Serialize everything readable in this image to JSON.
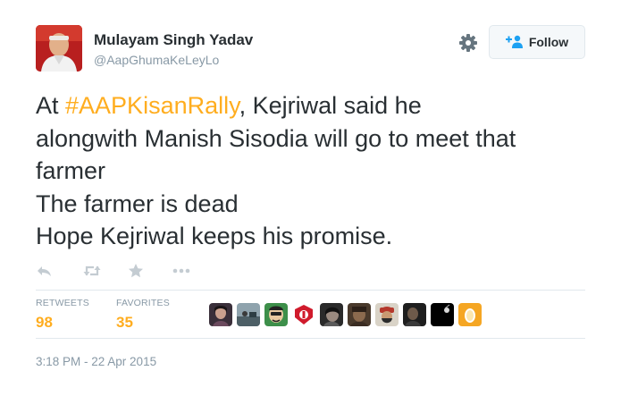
{
  "author": {
    "name": "Mulayam Singh Yadav",
    "handle": "@AapGhumaKeLeyLo"
  },
  "follow_button": {
    "label": "Follow"
  },
  "tweet": {
    "text_lines": [
      {
        "hashtag": "#AAPKisanRally",
        "prefix": "At ",
        "suffix": ", Kejriwal said he"
      },
      "alongwith Manish Sisodia will go to meet that",
      "farmer",
      "The farmer is dead",
      "Hope Kejriwal keeps his promise."
    ]
  },
  "stats": {
    "retweets": {
      "label": "RETWEETS",
      "value": "98"
    },
    "favorites": {
      "label": "FAVORITES",
      "value": "35"
    }
  },
  "timestamp": "3:18 PM - 22 Apr 2015",
  "icons": {
    "reply": "reply-icon",
    "retweet": "retweet-icon",
    "favorite": "star-icon",
    "more": "more-icon",
    "settings": "gear-icon",
    "follow": "add-user-icon"
  },
  "colors": {
    "hashtag": "#ffad1f",
    "stat_value": "#ffad1f",
    "muted": "#8899a6",
    "text": "#292f33",
    "divider": "#e1e8ed"
  }
}
